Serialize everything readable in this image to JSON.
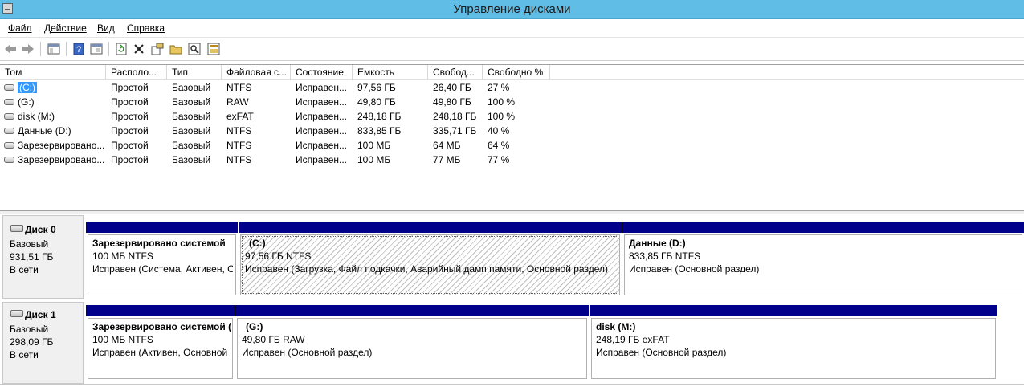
{
  "window": {
    "title": "Управление дисками"
  },
  "menu": [
    {
      "label": "Файл"
    },
    {
      "label": "Действие"
    },
    {
      "label": "Вид"
    },
    {
      "label": "Справка"
    }
  ],
  "toolbar": [
    "back-icon",
    "forward-icon",
    "console-tree-icon",
    "help-icon",
    "properties-icon",
    "refresh-icon",
    "delete-icon",
    "settings-icon",
    "open-icon",
    "search-icon",
    "export-icon"
  ],
  "table": {
    "columns": [
      "Том",
      "Располо...",
      "Тип",
      "Файловая с...",
      "Состояние",
      "Емкость",
      "Свобод...",
      "Свободно %"
    ],
    "rows": [
      [
        "(C:)",
        "Простой",
        "Базовый",
        "NTFS",
        "Исправен...",
        "97,56 ГБ",
        "26,40 ГБ",
        "27 %"
      ],
      [
        "(G:)",
        "Простой",
        "Базовый",
        "RAW",
        "Исправен...",
        "49,80 ГБ",
        "49,80 ГБ",
        "100 %"
      ],
      [
        "disk (M:)",
        "Простой",
        "Базовый",
        "exFAT",
        "Исправен...",
        "248,18 ГБ",
        "248,18 ГБ",
        "100 %"
      ],
      [
        "Данные (D:)",
        "Простой",
        "Базовый",
        "NTFS",
        "Исправен...",
        "833,85 ГБ",
        "335,71 ГБ",
        "40 %"
      ],
      [
        "Зарезервировано...",
        "Простой",
        "Базовый",
        "NTFS",
        "Исправен...",
        "100 МБ",
        "64 МБ",
        "64 %"
      ],
      [
        "Зарезервировано...",
        "Простой",
        "Базовый",
        "NTFS",
        "Исправен...",
        "100 МБ",
        "77 МБ",
        "77 %"
      ]
    ]
  },
  "disks": [
    {
      "name": "Диск 0",
      "type": "Базовый",
      "size": "931,51 ГБ",
      "status": "В сети",
      "partitions": [
        {
          "name": "Зарезервировано системой",
          "fs": "100 МБ NTFS",
          "status": "Исправен (Система, Активен, О"
        },
        {
          "name": "(C:)",
          "fs": "97,56 ГБ NTFS",
          "status": "Исправен (Загрузка, Файл подкачки, Аварийный дамп памяти, Основной раздел)"
        },
        {
          "name": "Данные  (D:)",
          "fs": "833,85 ГБ NTFS",
          "status": "Исправен (Основной раздел)"
        }
      ]
    },
    {
      "name": "Диск 1",
      "type": "Базовый",
      "size": "298,09 ГБ",
      "status": "В сети",
      "partitions": [
        {
          "name": "Зарезервировано системой  (",
          "fs": "100 МБ NTFS",
          "status": "Исправен (Активен, Основной"
        },
        {
          "name": "(G:)",
          "fs": "49,80 ГБ RAW",
          "status": "Исправен (Основной раздел)"
        },
        {
          "name": "disk  (M:)",
          "fs": "248,19 ГБ exFAT",
          "status": "Исправен (Основной раздел)"
        }
      ]
    }
  ]
}
